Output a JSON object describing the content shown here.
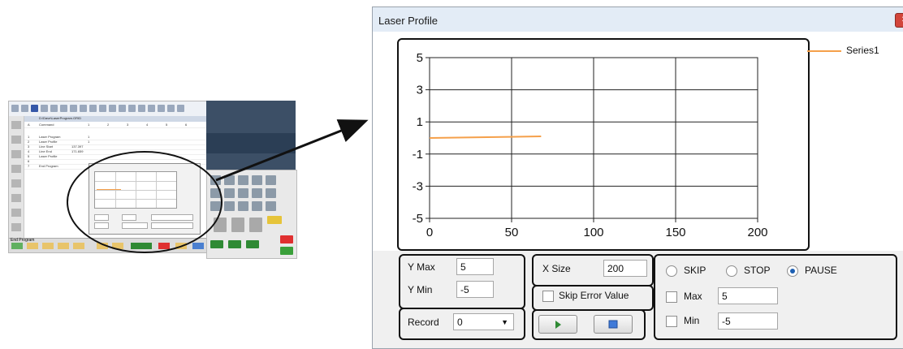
{
  "thumbnail": {
    "path_text": "D:\\Dave\\LaserProgram.GRID",
    "grid_header": [
      "A",
      "Command",
      "1",
      "2",
      "3",
      "4",
      "5",
      "6"
    ],
    "rows": [
      {
        "n": "1",
        "cmd": "Laser Program",
        "v1": "1"
      },
      {
        "n": "2",
        "cmd": "Laser Profile",
        "v1": "1"
      },
      {
        "n": "3",
        "cmd": "Line Start",
        "v1": "137.397"
      },
      {
        "n": "4",
        "cmd": "Line End",
        "v1": "171.659"
      },
      {
        "n": "5",
        "cmd": "Laser Profile",
        "v1": ""
      },
      {
        "n": "6",
        "cmd": "",
        "v1": ""
      },
      {
        "n": "7",
        "cmd": "End Program",
        "v1": ""
      }
    ],
    "bottom_label": "End Program"
  },
  "window": {
    "title": "Laser Profile",
    "close_symbol": "✕"
  },
  "chart_data": {
    "type": "line",
    "series": [
      {
        "name": "Series1",
        "color": "#f5a04a",
        "x": [
          0,
          68
        ],
        "y": [
          0,
          0.1
        ]
      }
    ],
    "xlim": [
      0,
      200
    ],
    "ylim": [
      -5,
      5
    ],
    "x_ticks": [
      "0",
      "50",
      "100",
      "150",
      "200"
    ],
    "y_ticks": [
      "5",
      "3",
      "1",
      "-1",
      "-3",
      "-5"
    ],
    "grid": true,
    "legend": "top-right"
  },
  "controls": {
    "y_max_label": "Y Max",
    "y_max_value": "5",
    "y_min_label": "Y Min",
    "y_min_value": "-5",
    "record_label": "Record",
    "record_value": "0",
    "x_size_label": "X Size",
    "x_size_value": "200",
    "skip_error_label": "Skip Error Value",
    "skip_label": "SKIP",
    "stop_label": "STOP",
    "pause_label": "PAUSE",
    "selected_mode": "PAUSE",
    "max_label": "Max",
    "max_value": "5",
    "min_label": "Min",
    "min_value": "-5"
  }
}
